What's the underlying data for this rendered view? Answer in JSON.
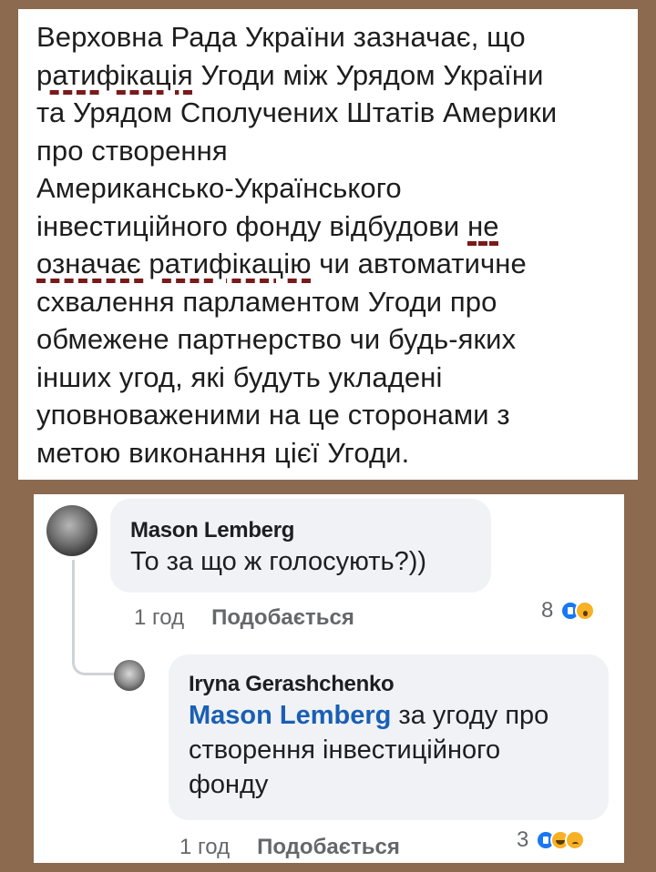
{
  "document": {
    "lines": [
      {
        "text": "Верховна Рада України зазначає, що"
      },
      {
        "marked": "ратифікація",
        "text": " Угоди між Урядом України"
      },
      {
        "text": "та Урядом Сполучених Штатів Америки"
      },
      {
        "text": "про створення"
      },
      {
        "text": "Американсько-Українського"
      },
      {
        "text": "інвестиційного фонду відбудови ",
        "marked_end": "не"
      },
      {
        "marked": "означає ратифікацію",
        "text": " чи автоматичне"
      },
      {
        "text": "схвалення парламентом Угоди про"
      },
      {
        "text": "обмежене партнерство чи будь-яких"
      },
      {
        "text": "інших угод, які будуть укладені"
      },
      {
        "text": "уповноваженими на це сторонами з"
      },
      {
        "text": "метою виконання цієї Угоди."
      }
    ]
  },
  "comments": [
    {
      "author": "Mason Lemberg",
      "lines": [
        "То за що ж голосують?))"
      ],
      "time": "1 год",
      "like_label": "Подобається",
      "reaction_count": "8",
      "reactions": [
        "like-icon",
        "wow-icon"
      ]
    },
    {
      "author": "Iryna Gerashchenko",
      "mention": "Mason Lemberg",
      "lines": [
        " за угоду про",
        "створення інвестиційного",
        "фонду"
      ],
      "time": "1 год",
      "like_label": "Подобається",
      "reaction_count": "3",
      "reactions": [
        "like-icon",
        "haha-icon",
        "sad-icon"
      ]
    }
  ],
  "colors": {
    "background": "#8c6a4f",
    "underline_mark": "#7a1a1a",
    "mention": "#1a5fb4",
    "bubble": "#f0f2f5"
  }
}
